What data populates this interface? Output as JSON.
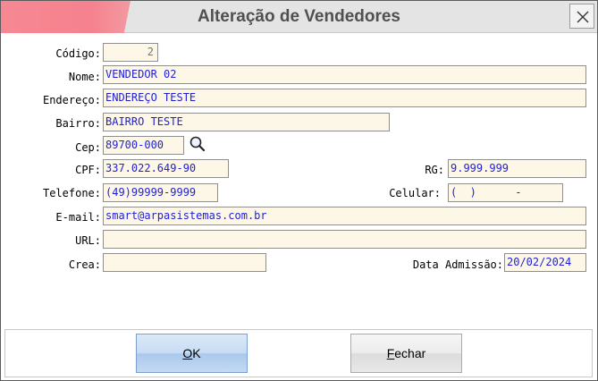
{
  "window": {
    "title": "Alteração de Vendedores",
    "close_icon": "close-icon"
  },
  "form": {
    "codigo": {
      "label": "Código:",
      "value": "2"
    },
    "nome": {
      "label": "Nome:",
      "value": "VENDEDOR 02"
    },
    "endereco": {
      "label": "Endereço:",
      "value": "ENDEREÇO TESTE"
    },
    "bairro": {
      "label": "Bairro:",
      "value": "BAIRRO TESTE"
    },
    "cep": {
      "label": "Cep:",
      "value": "89700-000",
      "icon": "search-icon"
    },
    "cpf": {
      "label": "CPF:",
      "value": "337.022.649-90"
    },
    "rg": {
      "label": "RG:",
      "value": "9.999.999"
    },
    "telefone": {
      "label": "Telefone:",
      "value": "(49)99999-9999"
    },
    "celular": {
      "label": "Celular:",
      "value": "(  )      -"
    },
    "email": {
      "label": "E-mail:",
      "value": "smart@arpasistemas.com.br"
    },
    "url": {
      "label": "URL:",
      "value": ""
    },
    "crea": {
      "label": "Crea:",
      "value": ""
    },
    "data_admissao": {
      "label": "Data Admissão:",
      "value": "20/02/2024"
    }
  },
  "buttons": {
    "ok": {
      "accel": "O",
      "rest": "K"
    },
    "fechar": {
      "accel": "F",
      "rest": "echar"
    }
  },
  "colors": {
    "title_accent": "#f78893",
    "field_bg": "#fdf7e8",
    "field_text": "#1f1fd6"
  }
}
